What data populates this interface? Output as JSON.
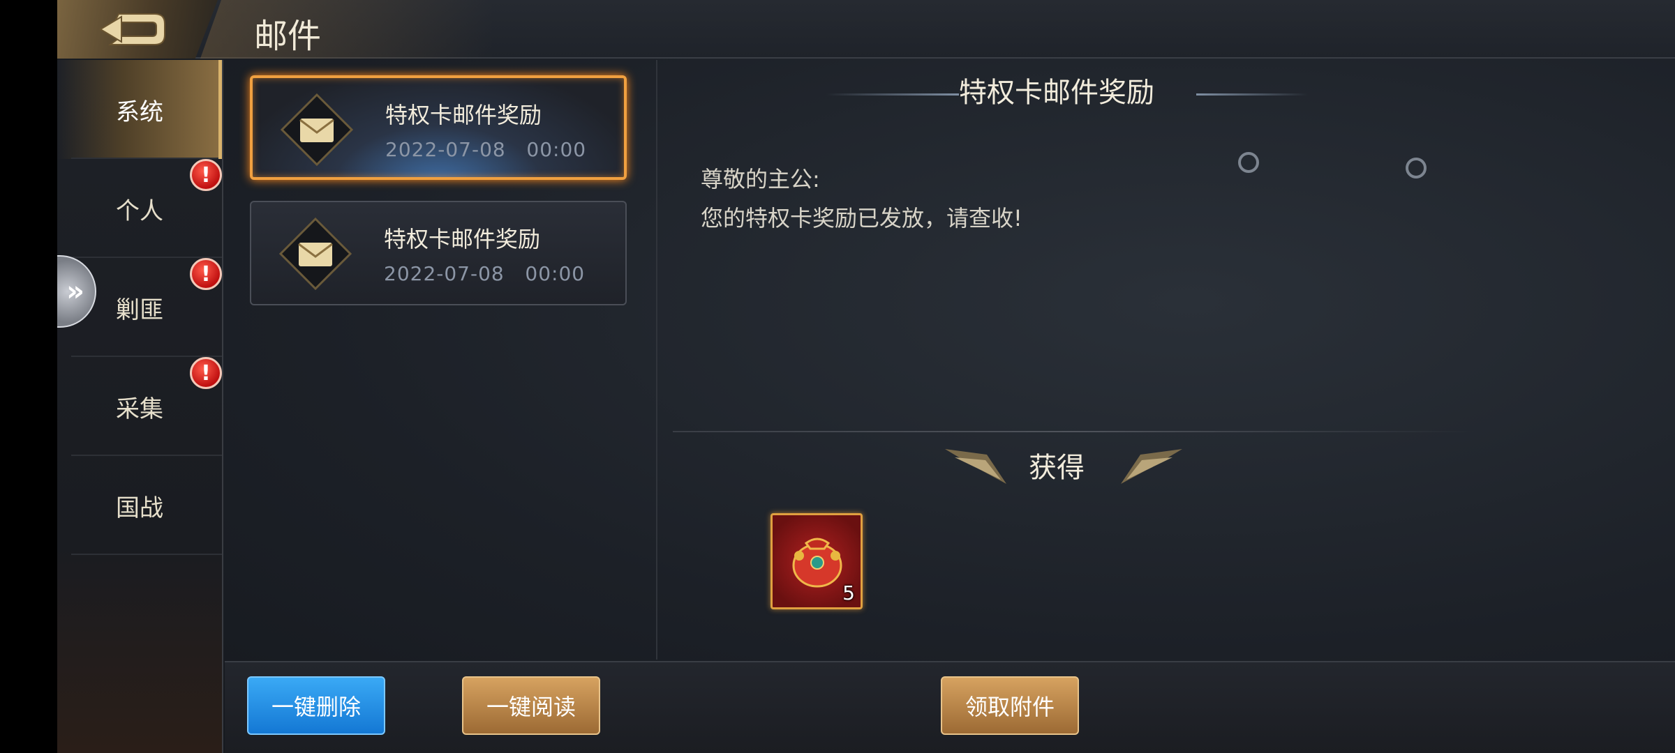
{
  "header": {
    "title": "邮件"
  },
  "sidebar": {
    "items": [
      {
        "label": "系统",
        "active": true,
        "badge": ""
      },
      {
        "label": "个人",
        "active": false,
        "badge": "!"
      },
      {
        "label": "剿匪",
        "active": false,
        "badge": "!"
      },
      {
        "label": "采集",
        "active": false,
        "badge": "!"
      },
      {
        "label": "国战",
        "active": false,
        "badge": ""
      }
    ],
    "fold_icon": "»"
  },
  "mail_list": [
    {
      "title": "特权卡邮件奖励",
      "date": "2022-07-08   00:00",
      "selected": true
    },
    {
      "title": "特权卡邮件奖励",
      "date": "2022-07-08   00:00",
      "selected": false
    }
  ],
  "content": {
    "title": "特权卡邮件奖励",
    "greeting": "尊敬的主公:",
    "message": "您的特权卡奖励已发放，请查收!",
    "obtain_label": "获得",
    "reward": {
      "icon": "red-pouch-icon",
      "quantity": "5"
    }
  },
  "footer": {
    "delete_all": "一键删除",
    "read_all": "一键阅读",
    "claim": "领取附件"
  },
  "colors": {
    "accent_gold": "#d9b36c",
    "selected_border": "#f0a040",
    "blue_button": "#1478d4"
  }
}
